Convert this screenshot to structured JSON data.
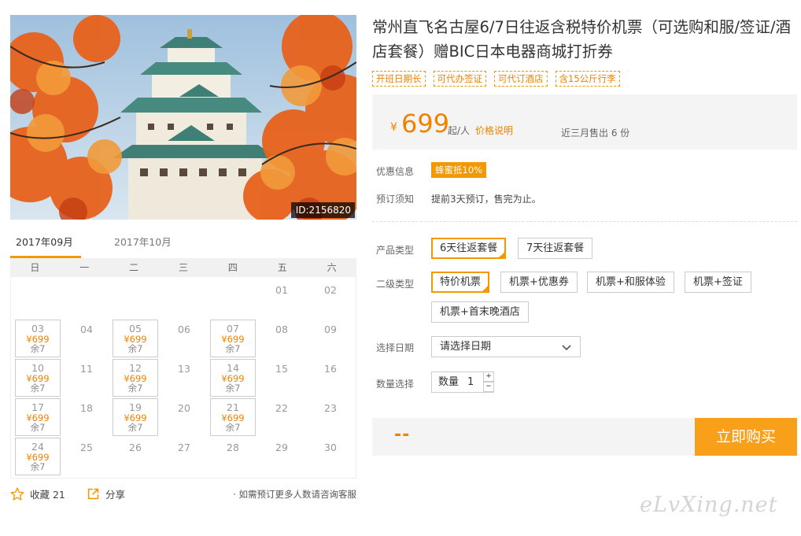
{
  "product": {
    "title": "常州直飞名古屋6/7日往返含税特价机票（可选购和服/签证/酒店套餐）赠BIC日本电器商城打折券",
    "tags": [
      "开班日期长",
      "可代办签证",
      "可代订酒店",
      "含15公斤行李"
    ],
    "image_id": "ID:2156820"
  },
  "price": {
    "currency": "¥",
    "amount": "699",
    "unit": "起/人",
    "explain_link": "价格说明",
    "sold": "近三月售出 6 份"
  },
  "info": {
    "promo_label": "优惠信息",
    "promo_badge": "蜂蜜抵10%",
    "notice_label": "预订须知",
    "notice_text": "提前3天预订，售完为止。"
  },
  "options": {
    "product_type_label": "产品类型",
    "product_types": [
      "6天往返套餐",
      "7天往返套餐"
    ],
    "sub_type_label": "二级类型",
    "sub_types": [
      "特价机票",
      "机票+优惠券",
      "机票+和服体验",
      "机票+签证",
      "机票+首末晚酒店"
    ],
    "date_label": "选择日期",
    "date_placeholder": "请选择日期",
    "qty_label": "数量选择",
    "qty_inner_label": "数量",
    "qty_value": "1",
    "qty_plus": "+",
    "qty_minus": "−"
  },
  "buy": {
    "total": "--",
    "button": "立即购买"
  },
  "calendar": {
    "months": [
      "2017年09月",
      "2017年10月"
    ],
    "weekdays": [
      "日",
      "一",
      "二",
      "三",
      "四",
      "五",
      "六"
    ],
    "rows": [
      [
        null,
        null,
        null,
        null,
        null,
        {
          "d": "01"
        },
        {
          "d": "02"
        }
      ],
      [
        {
          "d": "03",
          "p": "¥699",
          "r": "余7"
        },
        {
          "d": "04"
        },
        {
          "d": "05",
          "p": "¥699",
          "r": "余7"
        },
        {
          "d": "06"
        },
        {
          "d": "07",
          "p": "¥699",
          "r": "余7"
        },
        {
          "d": "08"
        },
        {
          "d": "09"
        }
      ],
      [
        {
          "d": "10",
          "p": "¥699",
          "r": "余7"
        },
        {
          "d": "11"
        },
        {
          "d": "12",
          "p": "¥699",
          "r": "余7"
        },
        {
          "d": "13"
        },
        {
          "d": "14",
          "p": "¥699",
          "r": "余7"
        },
        {
          "d": "15"
        },
        {
          "d": "16"
        }
      ],
      [
        {
          "d": "17",
          "p": "¥699",
          "r": "余7"
        },
        {
          "d": "18"
        },
        {
          "d": "19",
          "p": "¥699",
          "r": "余7"
        },
        {
          "d": "20"
        },
        {
          "d": "21",
          "p": "¥699",
          "r": "余7"
        },
        {
          "d": "22"
        },
        {
          "d": "23"
        }
      ],
      [
        {
          "d": "24",
          "p": "¥699",
          "r": "余7"
        },
        {
          "d": "25"
        },
        {
          "d": "26"
        },
        {
          "d": "27"
        },
        {
          "d": "28"
        },
        {
          "d": "29"
        },
        {
          "d": "30"
        }
      ]
    ]
  },
  "actions": {
    "favorite": "收藏 21",
    "share": "分享",
    "consult": "· 如需预订更多人数请咨询客服"
  },
  "watermark": "eLvXing.net",
  "colors": {
    "accent": "#f39800",
    "price": "#f08200",
    "buy_button": "#f9a01b"
  },
  "icons": [
    "star-icon",
    "share-icon",
    "chevron-down-icon",
    "check-icon"
  ]
}
